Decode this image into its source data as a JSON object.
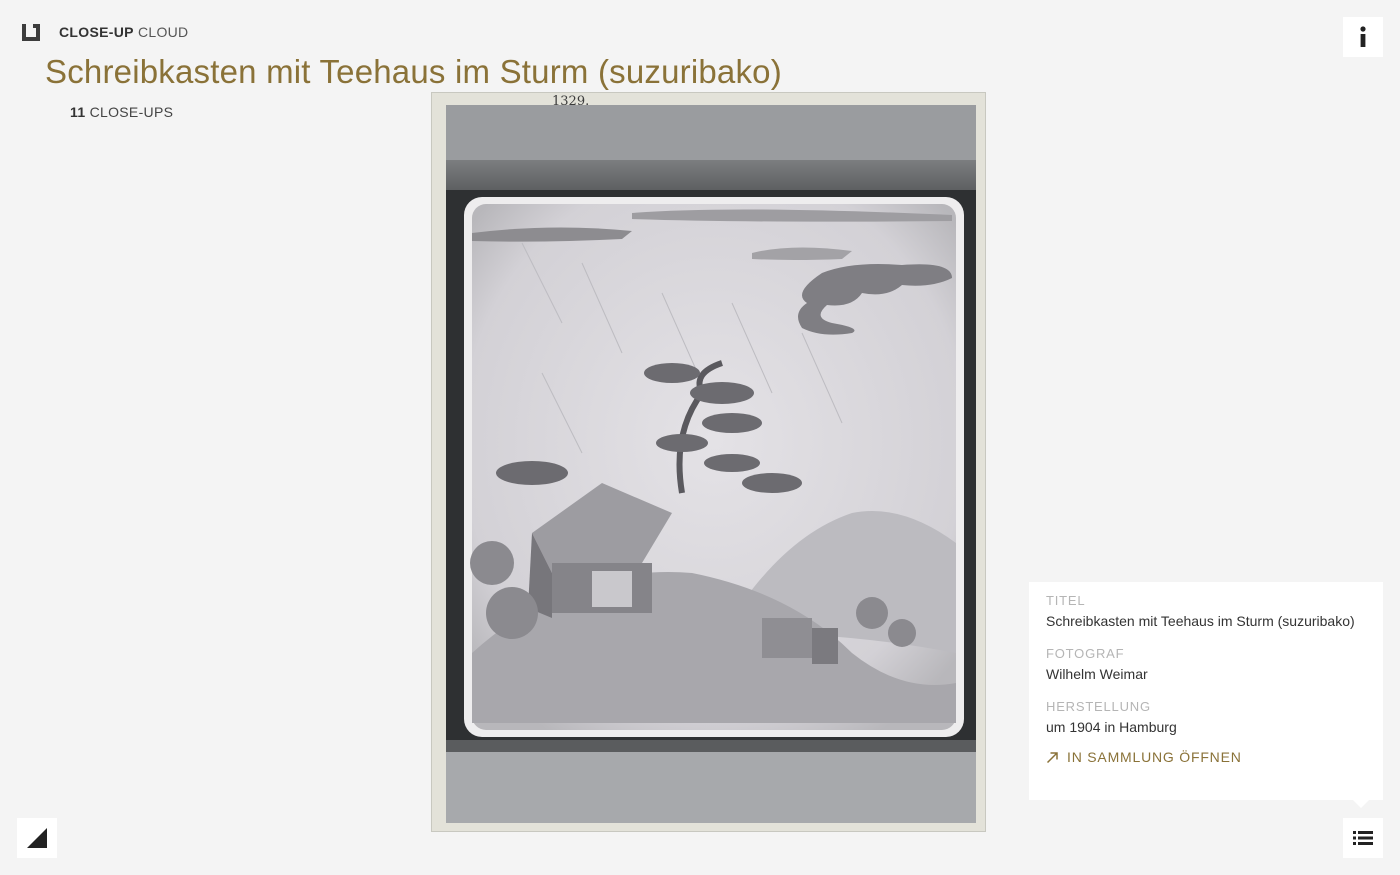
{
  "app": {
    "brand_strong": "CLOSE-UP",
    "brand_light": "CLOUD"
  },
  "header": {
    "title": "Schreibkasten mit Teehaus im Sturm (suzuribako)",
    "closeup_count": "11",
    "closeup_label": "CLOSE-UPS"
  },
  "photo": {
    "plate_annotation": "1329."
  },
  "metadata": {
    "fields": [
      {
        "label": "TITEL",
        "value": "Schreibkasten mit Teehaus im Sturm (suzuribako)"
      },
      {
        "label": "FOTOGRAF",
        "value": "Wilhelm Weimar"
      },
      {
        "label": "HERSTELLUNG",
        "value": "um 1904 in Hamburg"
      }
    ],
    "open_link_label": "IN SAMMLUNG ÖFFNEN"
  },
  "icons": {
    "brand": "bracket-logo-icon",
    "info": "info-icon",
    "fullscreen": "corner-triangle-icon",
    "list": "list-icon",
    "external": "arrow-up-right-icon"
  },
  "colors": {
    "background": "#f4f4f4",
    "accent": "#8a7238",
    "panel": "#ffffff",
    "label_muted": "#b5b5b5"
  }
}
